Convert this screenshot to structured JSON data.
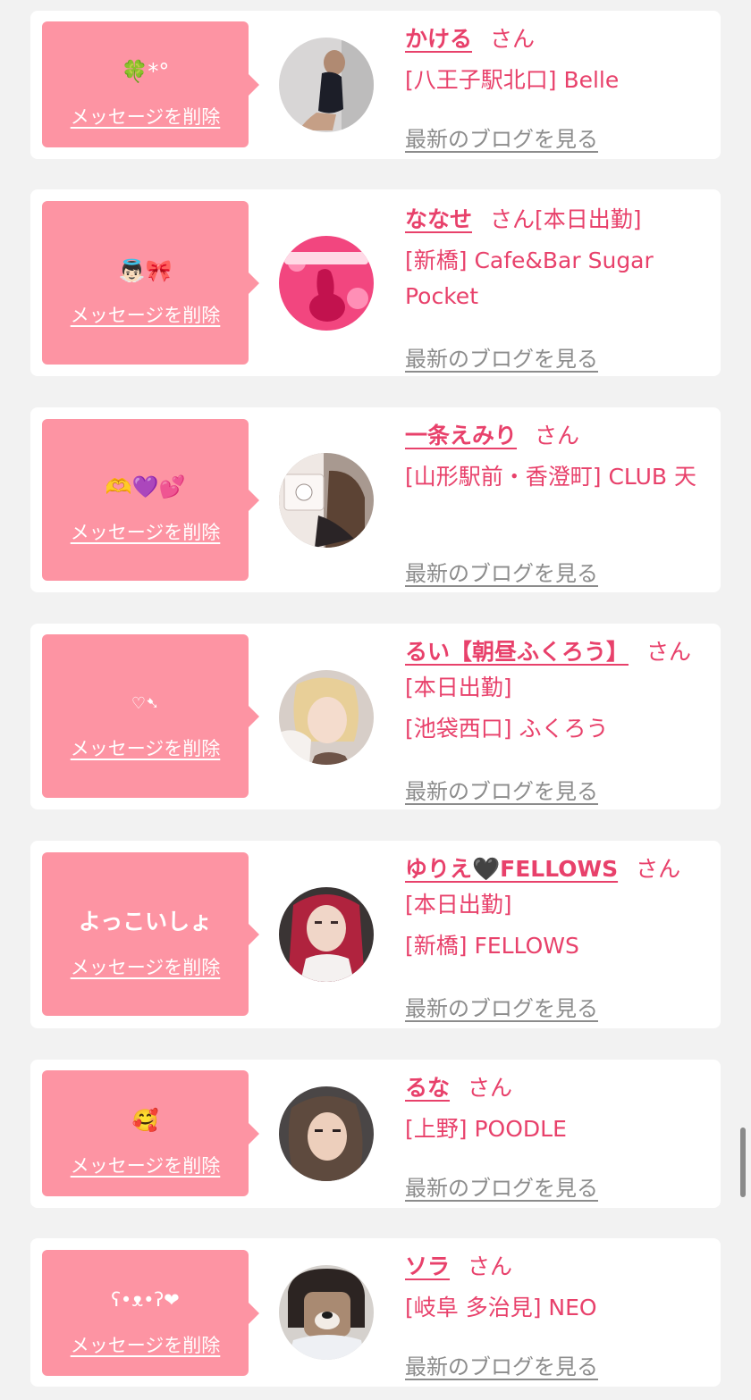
{
  "cards": [
    {
      "message": "🍀*°",
      "delete_label": "メッセージを削除",
      "name": "かける",
      "honorific": "さん",
      "status": "",
      "shop": "[八王子駅北口] Belle",
      "blog_label": "最新のブログを見る",
      "avatar": "photo-avatar"
    },
    {
      "message": "👼🏻🎀",
      "delete_label": "メッセージを削除",
      "name": "ななせ",
      "honorific": "さん",
      "status": "[本日出勤]",
      "shop": "[新橋] Cafe&Bar Sugar Pocket",
      "blog_label": "最新のブログを見る",
      "avatar": "photo-avatar"
    },
    {
      "message": "🫶💜💕",
      "delete_label": "メッセージを削除",
      "name": "一条えみり",
      "honorific": "さん",
      "status": "",
      "shop": "[山形駅前・香澄町] CLUB 天",
      "blog_label": "最新のブログを見る",
      "avatar": "photo-avatar"
    },
    {
      "message": "♡➷",
      "delete_label": "メッセージを削除",
      "name": "るい【朝昼ふくろう】",
      "honorific": "さん",
      "status": "[本日出勤]",
      "shop": "[池袋西口] ふくろう",
      "blog_label": "最新のブログを見る",
      "avatar": "photo-avatar"
    },
    {
      "message": "よっこいしょ",
      "delete_label": "メッセージを削除",
      "name": "ゆりえ🖤FELLOWS",
      "honorific": "さん",
      "status": "[本日出勤]",
      "shop": "[新橋] FELLOWS",
      "blog_label": "最新のブログを見る",
      "avatar": "photo-avatar"
    },
    {
      "message": "🥰",
      "delete_label": "メッセージを削除",
      "name": "るな",
      "honorific": "さん",
      "status": "",
      "shop": "[上野] POODLE",
      "blog_label": "最新のブログを見る",
      "avatar": "photo-avatar"
    },
    {
      "message": "ʕ•ᴥ•ʔ❤",
      "delete_label": "メッセージを削除",
      "name": "ソラ",
      "honorific": "さん",
      "status": "",
      "shop": "[岐阜 多治見] NEO",
      "blog_label": "最新のブログを見る",
      "avatar": "photo-avatar"
    }
  ],
  "colors": {
    "background": "#f2f2f2",
    "card": "#ffffff",
    "bubble": "#fd94a3",
    "name": "#e8416b",
    "blog_link": "#8c8c8c"
  }
}
